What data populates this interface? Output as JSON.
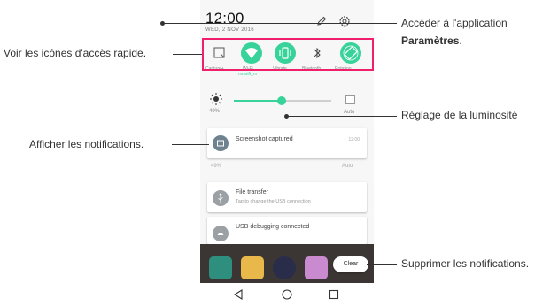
{
  "status": {
    "time": "12:00",
    "date": "WED, 2 NOV 2016"
  },
  "header_icons": [
    "edit-icon",
    "gear-icon"
  ],
  "quick_settings": {
    "tiles": [
      {
        "icon": "capture-plus-icon",
        "label": "Capture+",
        "active": false
      },
      {
        "icon": "wifi-icon",
        "label": "Wi-Fi",
        "active": true
      },
      {
        "icon": "vibrate-icon",
        "label": "Vibrate",
        "active": true
      },
      {
        "icon": "bluetooth-icon",
        "label": "Bluetooth",
        "active": false
      },
      {
        "icon": "rotation-icon",
        "label": "Rotation",
        "active": true
      }
    ],
    "wifi_network": "mowifi_m"
  },
  "brightness": {
    "percent_label": "49%",
    "level": 0.49,
    "auto_label": "Auto"
  },
  "notifications": [
    {
      "title": "Screenshot captured",
      "subtitle": "",
      "time": "12:00",
      "icon": "image-icon"
    },
    {
      "title": "File transfer",
      "subtitle": "Tap to change the USB connection",
      "time": "",
      "icon": "usb-icon"
    },
    {
      "title": "USB debugging connected",
      "subtitle": "",
      "time": "",
      "icon": "android-icon"
    }
  ],
  "ghost_row": {
    "percent": "49%",
    "auto": "Auto"
  },
  "clear_button": "Clear",
  "colors": {
    "accent": "#38d39a",
    "highlight_box": "#ef1f6b"
  },
  "callouts": {
    "quick_access": "Voir les icônes d'accès rapide.",
    "settings_line1": "Accéder à l'application",
    "settings_line2": "Paramètres",
    "settings_period": ".",
    "brightness": "Réglage de la luminosité",
    "notifications": "Afficher les notifications.",
    "clear": "Supprimer les notifications."
  }
}
